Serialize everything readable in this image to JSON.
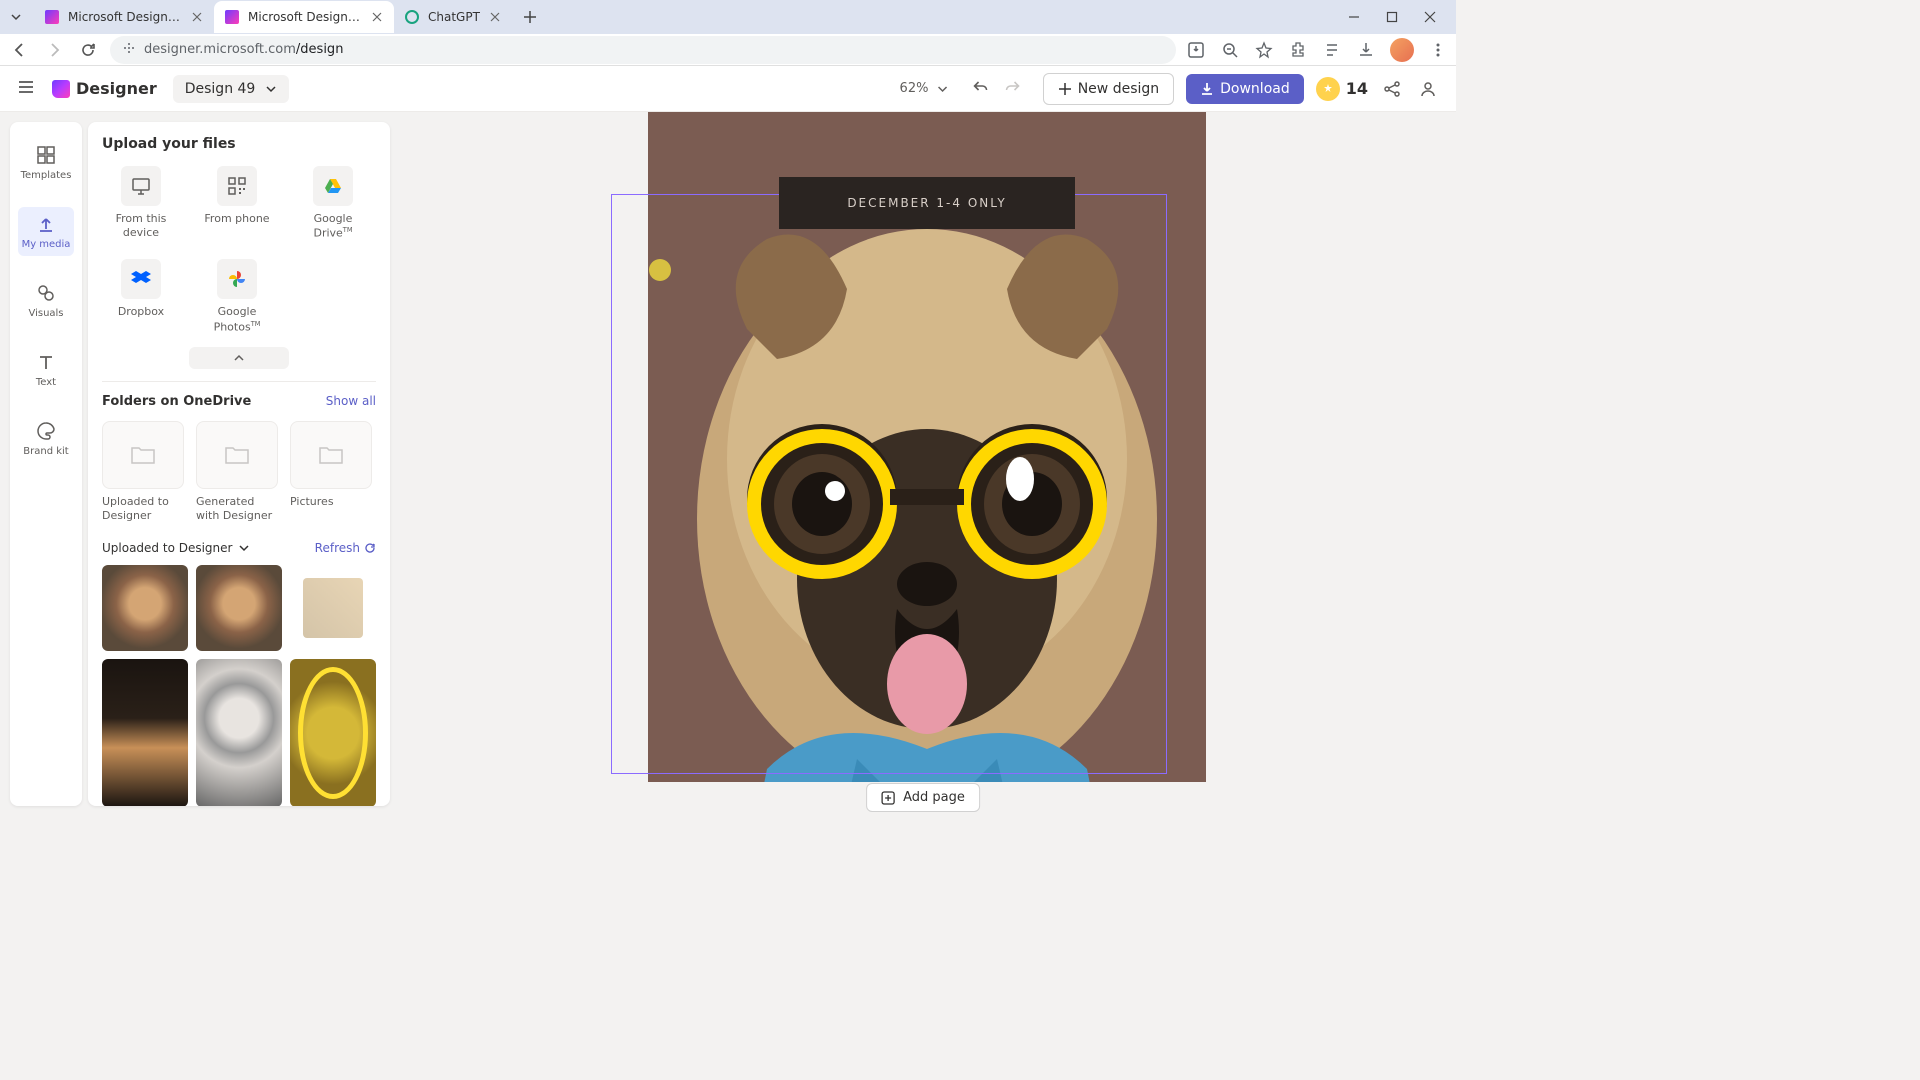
{
  "browser": {
    "tabs": [
      {
        "title": "Microsoft Designer - Stunning"
      },
      {
        "title": "Microsoft Designer - Stunning"
      },
      {
        "title": "ChatGPT"
      }
    ],
    "url": {
      "host": "designer.microsoft.com",
      "path": "/design"
    }
  },
  "app_bar": {
    "logo_text": "Designer",
    "design_name": "Design 49",
    "zoom": "62%",
    "new_design": "New design",
    "download": "Download",
    "credits": "14"
  },
  "side_rail": {
    "items": [
      {
        "label": "Templates"
      },
      {
        "label": "My media"
      },
      {
        "label": "Visuals"
      },
      {
        "label": "Text"
      },
      {
        "label": "Brand kit"
      }
    ]
  },
  "panel": {
    "upload_title": "Upload your files",
    "upload_sources": [
      {
        "label": "From this device"
      },
      {
        "label": "From phone"
      },
      {
        "label": "Google Drive"
      },
      {
        "label": "Dropbox"
      },
      {
        "label": "Google Photos"
      }
    ],
    "folders_title": "Folders on OneDrive",
    "show_all": "Show all",
    "folders": [
      {
        "label": "Uploaded to Designer"
      },
      {
        "label": "Generated with Designer"
      },
      {
        "label": "Pictures"
      }
    ],
    "media_filter": "Uploaded to Designer",
    "refresh": "Refresh"
  },
  "canvas": {
    "banner_text": "DECEMBER 1-4 ONLY",
    "add_page": "Add page"
  }
}
